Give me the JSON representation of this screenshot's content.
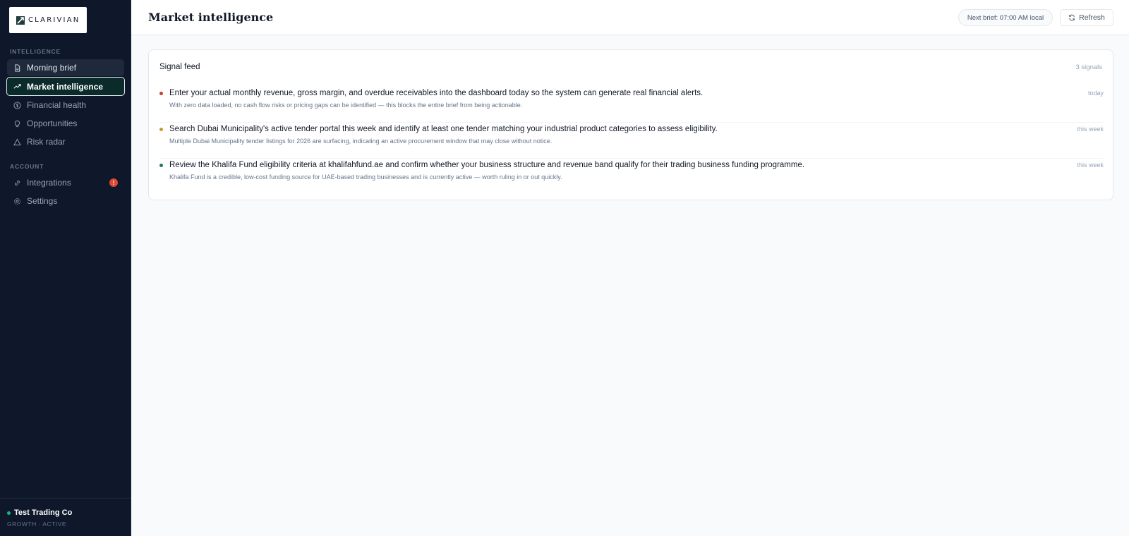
{
  "brand": {
    "logo_text": "CLARIVIAN"
  },
  "sidebar": {
    "sections": [
      {
        "label": "INTELLIGENCE",
        "items": [
          {
            "label": "Morning brief",
            "icon": "document-icon"
          },
          {
            "label": "Market intelligence",
            "icon": "trending-up-icon"
          },
          {
            "label": "Financial health",
            "icon": "dollar-circle-icon"
          },
          {
            "label": "Opportunities",
            "icon": "lightbulb-icon"
          },
          {
            "label": "Risk radar",
            "icon": "warning-triangle-icon"
          }
        ]
      },
      {
        "label": "ACCOUNT",
        "items": [
          {
            "label": "Integrations",
            "icon": "link-icon",
            "badge": "!"
          },
          {
            "label": "Settings",
            "icon": "gear-icon"
          }
        ]
      }
    ],
    "footer": {
      "company": "Test Trading Co",
      "plan": "GROWTH · ACTIVE",
      "status_color": "#10b981"
    }
  },
  "header": {
    "title": "Market intelligence",
    "next_brief": "Next brief: 07:00 AM local",
    "refresh_label": "Refresh"
  },
  "feed": {
    "title": "Signal feed",
    "count": "3 signals",
    "signals": [
      {
        "title": "Enter your actual monthly revenue, gross margin, and overdue receivables into the dashboard today so the system can generate real financial alerts.",
        "description": "With zero data loaded, no cash flow risks or pricing gaps can be identified — this blocks the entire brief from being actionable.",
        "when": "today",
        "color": "#c2412d"
      },
      {
        "title": "Search Dubai Municipality's active tender portal this week and identify at least one tender matching your industrial product categories to assess eligibility.",
        "description": "Multiple Dubai Municipality tender listings for 2026 are surfacing, indicating an active procurement window that may close without notice.",
        "when": "this week",
        "color": "#c99a2e"
      },
      {
        "title": "Review the Khalifa Fund eligibility criteria at khalifahfund.ae and confirm whether your business structure and revenue band qualify for their trading business funding programme.",
        "description": "Khalifa Fund is a credible, low-cost funding source for UAE-based trading businesses and is currently active — worth ruling in or out quickly.",
        "when": "this week",
        "color": "#1f7a5a"
      }
    ]
  },
  "colors": {
    "sidebar_bg": "#0f172a",
    "active_bg": "#0b2b2b",
    "badge": "#dc4a36"
  }
}
